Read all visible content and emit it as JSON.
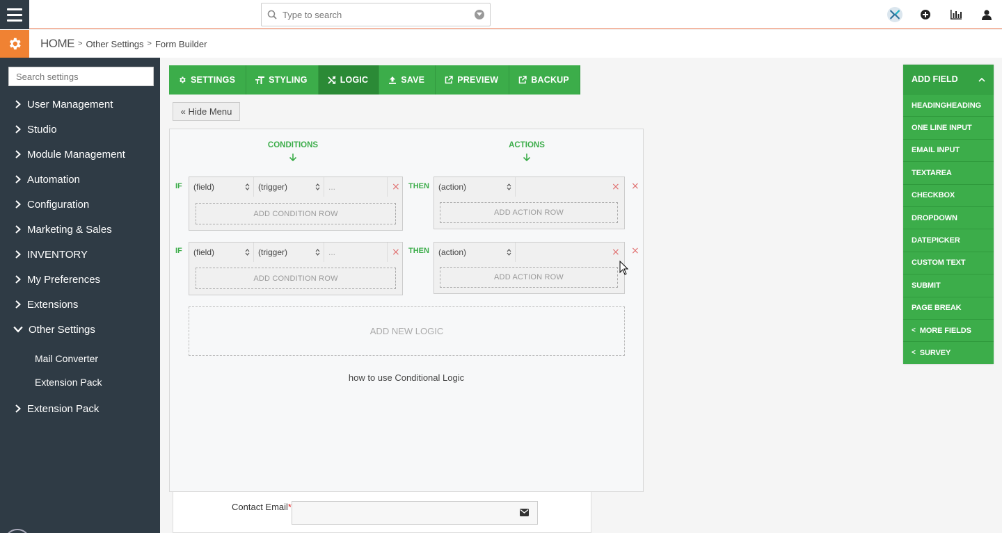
{
  "topbar": {
    "search_placeholder": "Type to search",
    "icons": [
      "menu-icon",
      "search-icon",
      "chevron-down-icon",
      "brand-logo-icon",
      "plus-circle-icon",
      "reports-icon",
      "user-icon"
    ]
  },
  "breadcrumb": {
    "home": "HOME",
    "sep": ">",
    "level1": "Other Settings",
    "level2": "Form Builder"
  },
  "sidebar": {
    "search_placeholder": "Search settings",
    "items": [
      {
        "label": "User Management"
      },
      {
        "label": "Studio"
      },
      {
        "label": "Module Management"
      },
      {
        "label": "Automation"
      },
      {
        "label": "Configuration"
      },
      {
        "label": "Marketing & Sales"
      },
      {
        "label": "INVENTORY"
      },
      {
        "label": "My Preferences"
      },
      {
        "label": "Extensions"
      },
      {
        "label": "Other Settings"
      },
      {
        "label": "Extension Pack"
      }
    ],
    "subitems": [
      {
        "label": "Mail Converter"
      },
      {
        "label": "Extension Pack"
      }
    ]
  },
  "toolbar": {
    "settings": "SETTINGS",
    "styling": "STYLING",
    "logic": "LOGIC",
    "save": "SAVE",
    "preview": "PREVIEW",
    "backup": "BACKUP",
    "active": "LOGIC"
  },
  "hide_menu": "« Hide Menu",
  "logic": {
    "conditions_head": "CONDITIONS",
    "actions_head": "ACTIONS",
    "if": "IF",
    "then": "THEN",
    "field": "(field)",
    "trigger": "(trigger)",
    "value": "...",
    "action": "(action)",
    "remove": "×",
    "add_condition_row": "ADD CONDITION ROW",
    "add_action_row": "ADD ACTION ROW",
    "add_new_logic": "ADD NEW LOGIC",
    "help": "how to use Conditional Logic"
  },
  "form": {
    "contact_email_label": "Contact Email",
    "required_mark": "*"
  },
  "field_panel": {
    "title": "ADD FIELD",
    "items": [
      "HEADINGHEADING",
      "ONE LINE INPUT",
      "EMAIL INPUT",
      "TEXTAREA",
      "CHECKBOX",
      "DROPDOWN",
      "DATEPICKER",
      "CUSTOM TEXT",
      "SUBMIT",
      "PAGE BREAK"
    ],
    "more_fields": "MORE FIELDS",
    "survey": "SURVEY",
    "back_glyph": "<"
  },
  "colors": {
    "accent_green": "#3cad4a",
    "active_green": "#2b8a36",
    "sidebar_bg": "#2f3b45",
    "brand_orange": "#f08233"
  }
}
